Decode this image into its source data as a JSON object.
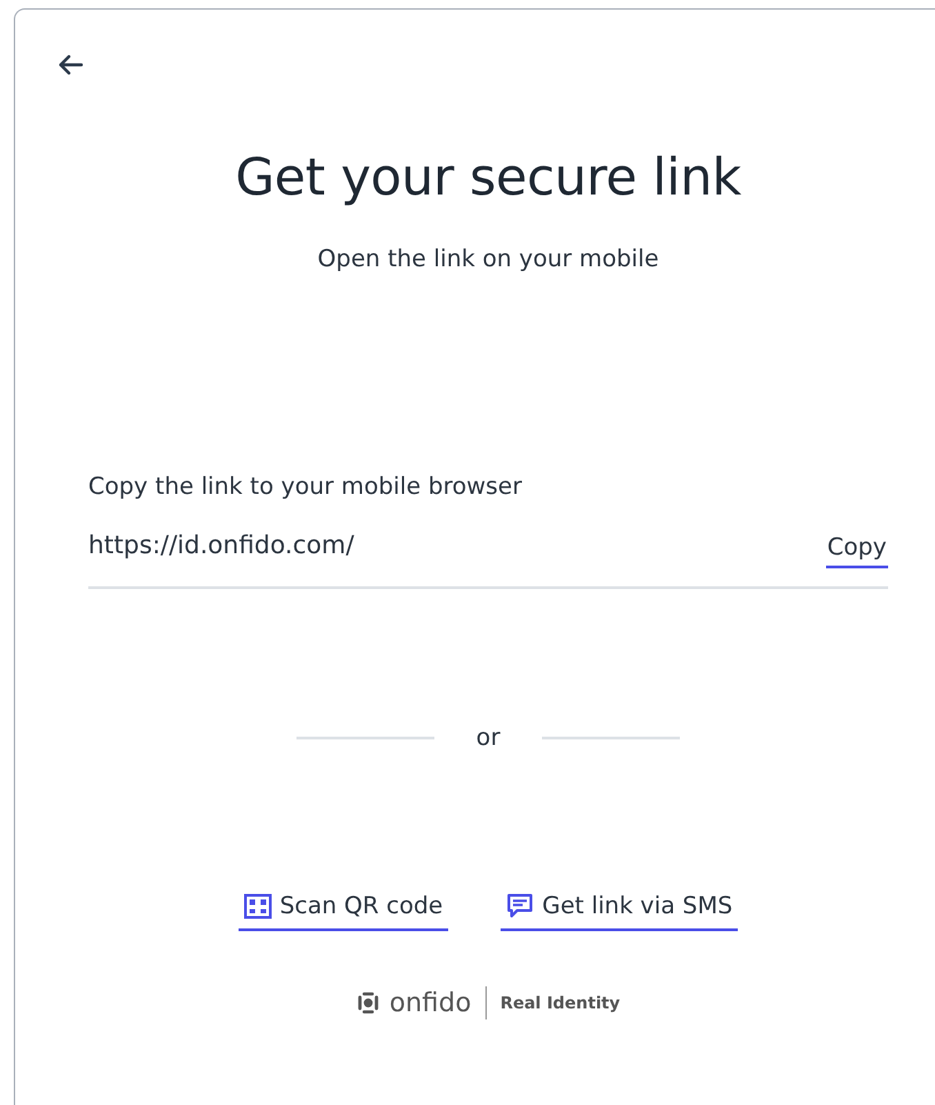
{
  "title": "Get your secure link",
  "subtitle": "Open the link on your mobile",
  "link_section": {
    "label": "Copy the link to your mobile browser",
    "value": "https://id.onfido.com/",
    "copy_button": "Copy"
  },
  "divider_text": "or",
  "options": [
    {
      "kind": "qr",
      "label": "Scan QR code"
    },
    {
      "kind": "sms",
      "label": "Get link via SMS"
    }
  ],
  "footer": {
    "brand": "onfido",
    "tagline": "Real Identity"
  }
}
